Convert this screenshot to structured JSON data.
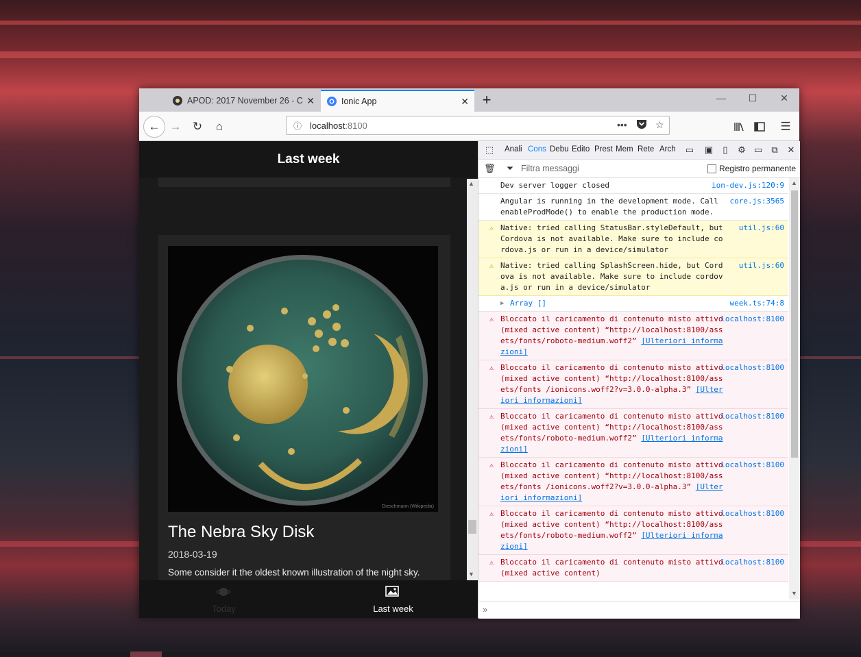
{
  "browser": {
    "tabs": [
      {
        "title": "APOD: 2017 November 26 - C",
        "active": false
      },
      {
        "title": "Ionic App",
        "active": true
      }
    ],
    "new_tab": "+",
    "window_controls": {
      "minimize": "—",
      "maximize": "☐",
      "close": "✕"
    },
    "url": {
      "host": "localhost",
      "port": ":8100"
    },
    "page_actions": "•••"
  },
  "app": {
    "header_title": "Last week",
    "card": {
      "title": "The Nebra Sky Disk",
      "date": "2018-03-19",
      "description": "Some consider it the oldest known illustration of the night sky.",
      "credit": "Dieschmann (Wikipedia)"
    },
    "tabs": [
      {
        "label": "Today",
        "active": false
      },
      {
        "label": "Last week",
        "active": true
      }
    ]
  },
  "devtools": {
    "tabs": [
      "Anali",
      "Cons",
      "Debu",
      "Edito",
      "Prest",
      "Mem",
      "Rete",
      "Arch"
    ],
    "selected_tab": "Cons",
    "filter_placeholder": "Filtra messaggi",
    "persist_label": "Registro permanente",
    "messages": [
      {
        "type": "log",
        "text": "Dev server logger closed",
        "source": "ion-dev.js:120:9"
      },
      {
        "type": "log",
        "text": "Angular is running in the development mode. Call enableProdMode() to enable the production mode.",
        "source": "core.js:3565"
      },
      {
        "type": "warn",
        "text": "Native: tried calling StatusBar.styleDefault, but Cordova is not available. Make sure to include cordova.js or run in a device/simulator",
        "source": "util.js:60"
      },
      {
        "type": "warn",
        "text": "Native: tried calling SplashScreen.hide, but Cordova is not available. Make sure to include cordova.js or run in a device/simulator",
        "source": "util.js:60"
      },
      {
        "type": "array",
        "text": "Array []",
        "source": "week.ts:74:8"
      },
      {
        "type": "err",
        "text": "Bloccato il caricamento di contenuto misto attivo (mixed active content) “http://localhost:8100/assets/fonts/roboto-medium.woff2”",
        "link": "[Ulteriori informazioni]",
        "source": "localhost:8100"
      },
      {
        "type": "err",
        "text": "Bloccato il caricamento di contenuto misto attivo (mixed active content) “http://localhost:8100/assets/fonts /ionicons.woff2?v=3.0.0-alpha.3”",
        "link": "[Ulteriori informazioni]",
        "source": "localhost:8100"
      },
      {
        "type": "err",
        "text": "Bloccato il caricamento di contenuto misto attivo (mixed active content) “http://localhost:8100/assets/fonts/roboto-medium.woff2”",
        "link": "[Ulteriori informazioni]",
        "source": "localhost:8100"
      },
      {
        "type": "err",
        "text": "Bloccato il caricamento di contenuto misto attivo (mixed active content) “http://localhost:8100/assets/fonts /ionicons.woff2?v=3.0.0-alpha.3”",
        "link": "[Ulteriori informazioni]",
        "source": "localhost:8100"
      },
      {
        "type": "err",
        "text": "Bloccato il caricamento di contenuto misto attivo (mixed active content) “http://localhost:8100/assets/fonts/roboto-medium.woff2”",
        "link": "[Ulteriori informazioni]",
        "source": "localhost:8100"
      },
      {
        "type": "err",
        "text": "Bloccato il caricamento di contenuto misto attivo (mixed active content)",
        "source": "localhost:8100"
      }
    ],
    "prompt": "»"
  },
  "colors": {
    "accent": "#0a84ff",
    "warn_bg": "#fffbd6",
    "err_bg": "#fdf2f5",
    "link": "#0074e8"
  }
}
